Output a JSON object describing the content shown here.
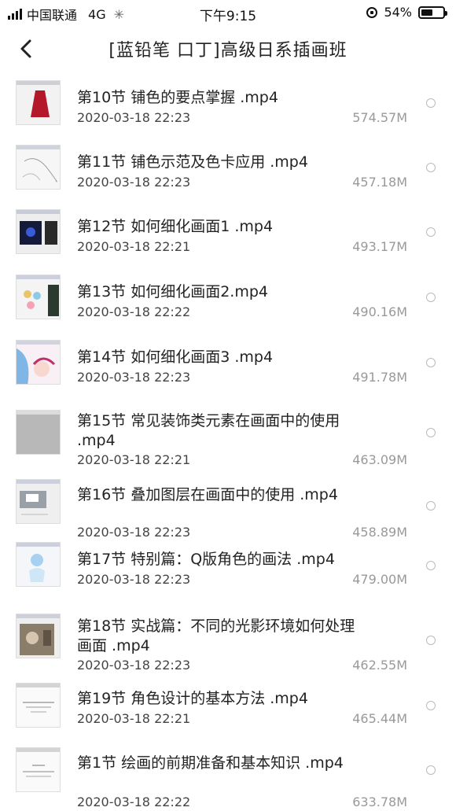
{
  "status_bar": {
    "carrier": "中国联通",
    "network": "4G",
    "time": "下午9:15",
    "battery": "54%",
    "battery_level": 0.54
  },
  "nav": {
    "back_icon": "chevron-left-icon",
    "title": "[蓝铅笔 口丁]高级日系插画班"
  },
  "files": [
    {
      "name": "第10节 铺色的要点掌握 .mp4",
      "date": "2020-03-18 22:23",
      "size": "574.57M"
    },
    {
      "name": "第11节 铺色示范及色卡应用 .mp4",
      "date": "2020-03-18 22:23",
      "size": "457.18M"
    },
    {
      "name": "第12节 如何细化画面1 .mp4",
      "date": "2020-03-18 22:21",
      "size": "493.17M"
    },
    {
      "name": "第13节 如何细化画面2.mp4",
      "date": "2020-03-18 22:22",
      "size": "490.16M"
    },
    {
      "name": "第14节 如何细化画面3 .mp4",
      "date": "2020-03-18 22:23",
      "size": "491.78M"
    },
    {
      "name": "第15节 常见装饰类元素在画面中的使用 .mp4",
      "date": "2020-03-18 22:21",
      "size": "463.09M"
    },
    {
      "name": "第16节 叠加图层在画面中的使用 .mp4",
      "date": "2020-03-18 22:23",
      "size": "458.89M"
    },
    {
      "name": "第17节 特别篇：Q版角色的画法 .mp4",
      "date": "2020-03-18 22:23",
      "size": "479.00M"
    },
    {
      "name": "第18节 实战篇：不同的光影环境如何处理画面 .mp4",
      "date": "2020-03-18 22:23",
      "size": "462.55M"
    },
    {
      "name": "第19节 角色设计的基本方法 .mp4",
      "date": "2020-03-18 22:21",
      "size": "465.44M"
    },
    {
      "name": "第1节 绘画的前期准备和基本知识 .mp4",
      "date": "2020-03-18 22:22",
      "size": "633.78M"
    }
  ]
}
